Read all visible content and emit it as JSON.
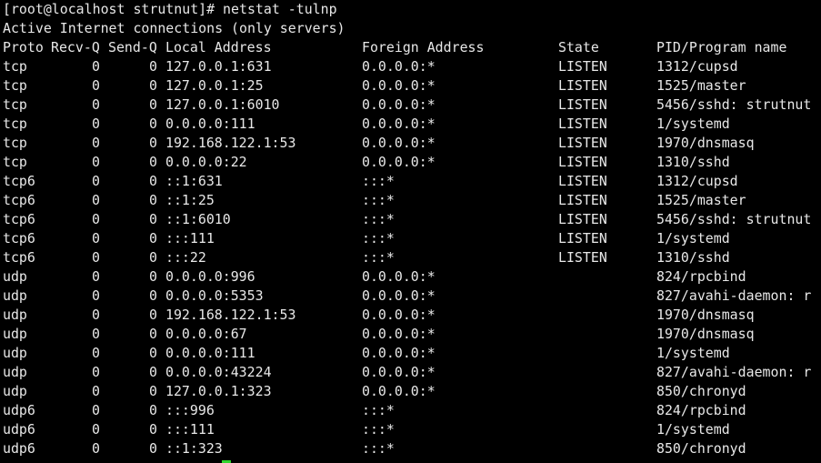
{
  "terminal": {
    "prompt_line": "[root@localhost strutnut]# netstat -tulnp",
    "info_line": "Active Internet connections (only servers)",
    "headers": {
      "proto": "Proto",
      "recv_q": "Recv-Q",
      "send_q": "Send-Q",
      "local": "Local Address",
      "foreign": "Foreign Address",
      "state": "State",
      "pid": "PID/Program name"
    },
    "rows": [
      {
        "proto": "tcp",
        "recv_q": "0",
        "send_q": "0",
        "local": "127.0.0.1:631",
        "foreign": "0.0.0.0:*",
        "state": "LISTEN",
        "pid": "1312/cupsd"
      },
      {
        "proto": "tcp",
        "recv_q": "0",
        "send_q": "0",
        "local": "127.0.0.1:25",
        "foreign": "0.0.0.0:*",
        "state": "LISTEN",
        "pid": "1525/master"
      },
      {
        "proto": "tcp",
        "recv_q": "0",
        "send_q": "0",
        "local": "127.0.0.1:6010",
        "foreign": "0.0.0.0:*",
        "state": "LISTEN",
        "pid": "5456/sshd: strutnut"
      },
      {
        "proto": "tcp",
        "recv_q": "0",
        "send_q": "0",
        "local": "0.0.0.0:111",
        "foreign": "0.0.0.0:*",
        "state": "LISTEN",
        "pid": "1/systemd"
      },
      {
        "proto": "tcp",
        "recv_q": "0",
        "send_q": "0",
        "local": "192.168.122.1:53",
        "foreign": "0.0.0.0:*",
        "state": "LISTEN",
        "pid": "1970/dnsmasq"
      },
      {
        "proto": "tcp",
        "recv_q": "0",
        "send_q": "0",
        "local": "0.0.0.0:22",
        "foreign": "0.0.0.0:*",
        "state": "LISTEN",
        "pid": "1310/sshd"
      },
      {
        "proto": "tcp6",
        "recv_q": "0",
        "send_q": "0",
        "local": "::1:631",
        "foreign": ":::*",
        "state": "LISTEN",
        "pid": "1312/cupsd"
      },
      {
        "proto": "tcp6",
        "recv_q": "0",
        "send_q": "0",
        "local": "::1:25",
        "foreign": ":::*",
        "state": "LISTEN",
        "pid": "1525/master"
      },
      {
        "proto": "tcp6",
        "recv_q": "0",
        "send_q": "0",
        "local": "::1:6010",
        "foreign": ":::*",
        "state": "LISTEN",
        "pid": "5456/sshd: strutnut"
      },
      {
        "proto": "tcp6",
        "recv_q": "0",
        "send_q": "0",
        "local": ":::111",
        "foreign": ":::*",
        "state": "LISTEN",
        "pid": "1/systemd"
      },
      {
        "proto": "tcp6",
        "recv_q": "0",
        "send_q": "0",
        "local": ":::22",
        "foreign": ":::*",
        "state": "LISTEN",
        "pid": "1310/sshd"
      },
      {
        "proto": "udp",
        "recv_q": "0",
        "send_q": "0",
        "local": "0.0.0.0:996",
        "foreign": "0.0.0.0:*",
        "state": "",
        "pid": "824/rpcbind"
      },
      {
        "proto": "udp",
        "recv_q": "0",
        "send_q": "0",
        "local": "0.0.0.0:5353",
        "foreign": "0.0.0.0:*",
        "state": "",
        "pid": "827/avahi-daemon: r"
      },
      {
        "proto": "udp",
        "recv_q": "0",
        "send_q": "0",
        "local": "192.168.122.1:53",
        "foreign": "0.0.0.0:*",
        "state": "",
        "pid": "1970/dnsmasq"
      },
      {
        "proto": "udp",
        "recv_q": "0",
        "send_q": "0",
        "local": "0.0.0.0:67",
        "foreign": "0.0.0.0:*",
        "state": "",
        "pid": "1970/dnsmasq"
      },
      {
        "proto": "udp",
        "recv_q": "0",
        "send_q": "0",
        "local": "0.0.0.0:111",
        "foreign": "0.0.0.0:*",
        "state": "",
        "pid": "1/systemd"
      },
      {
        "proto": "udp",
        "recv_q": "0",
        "send_q": "0",
        "local": "0.0.0.0:43224",
        "foreign": "0.0.0.0:*",
        "state": "",
        "pid": "827/avahi-daemon: r"
      },
      {
        "proto": "udp",
        "recv_q": "0",
        "send_q": "0",
        "local": "127.0.0.1:323",
        "foreign": "0.0.0.0:*",
        "state": "",
        "pid": "850/chronyd"
      },
      {
        "proto": "udp6",
        "recv_q": "0",
        "send_q": "0",
        "local": ":::996",
        "foreign": ":::*",
        "state": "",
        "pid": "824/rpcbind"
      },
      {
        "proto": "udp6",
        "recv_q": "0",
        "send_q": "0",
        "local": ":::111",
        "foreign": ":::*",
        "state": "",
        "pid": "1/systemd"
      },
      {
        "proto": "udp6",
        "recv_q": "0",
        "send_q": "0",
        "local": "::1:323",
        "foreign": ":::*",
        "state": "",
        "pid": "850/chronyd"
      }
    ]
  },
  "colors": {
    "background": "#000000",
    "text": "#e8e8e8",
    "cursor": "#2fd52f"
  }
}
